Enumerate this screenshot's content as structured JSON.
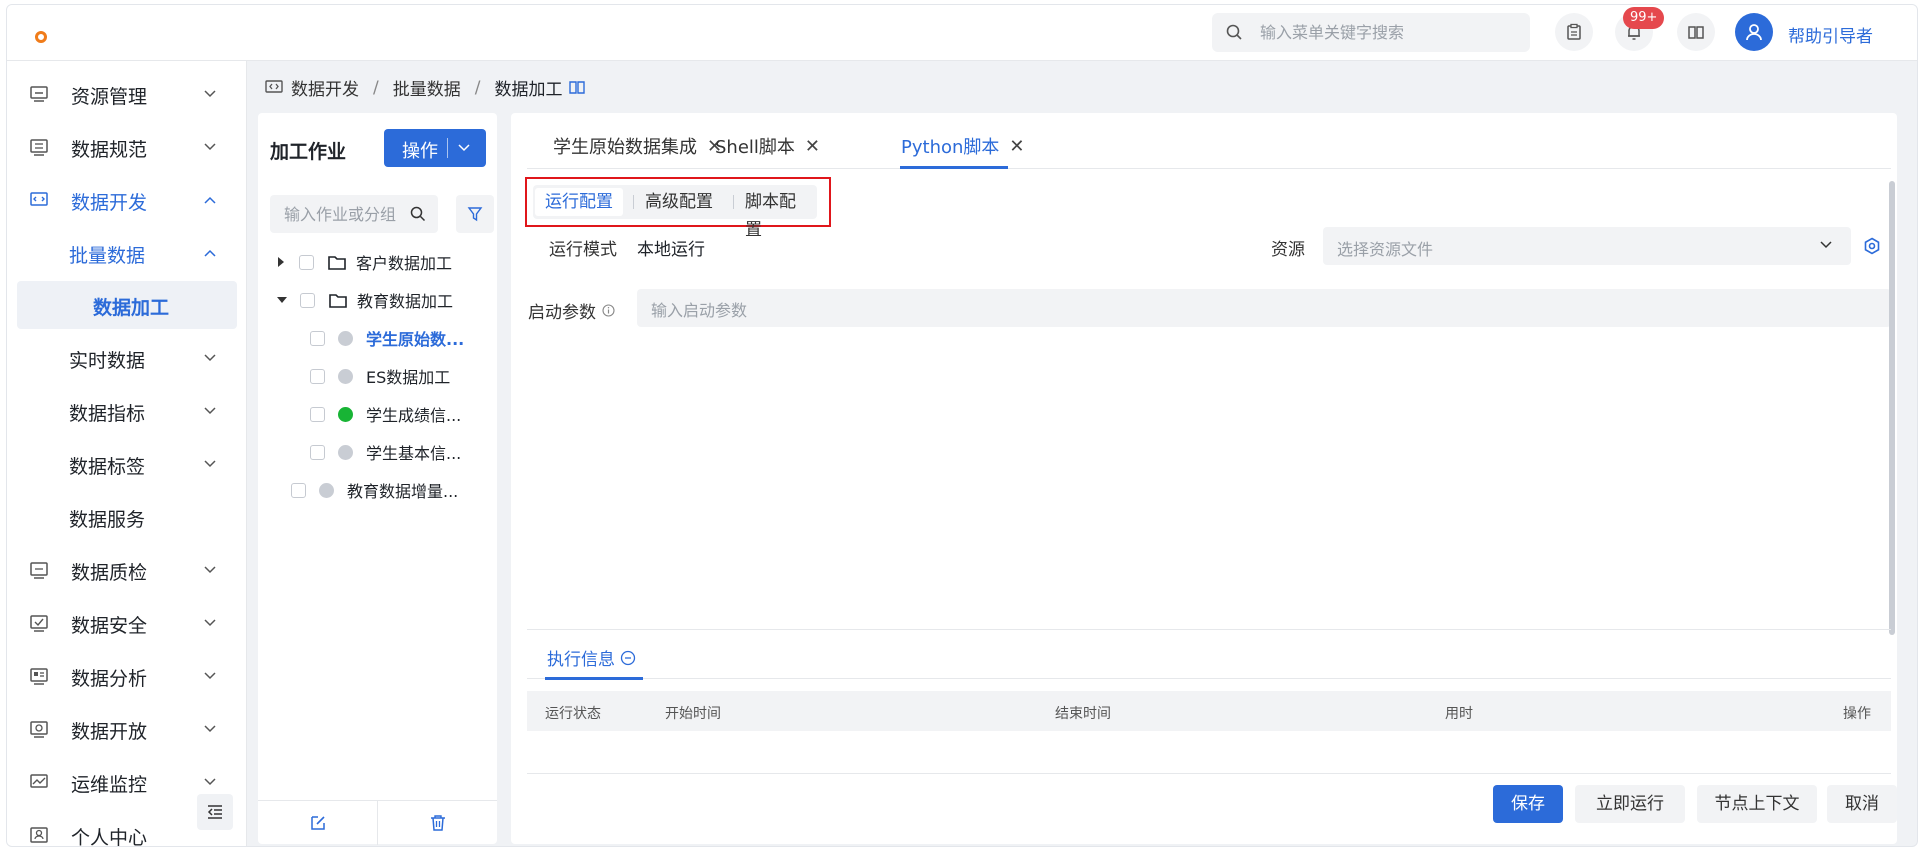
{
  "header": {
    "search_placeholder": "输入菜单关键字搜索",
    "notification_count": "99+",
    "username": "帮助引导者"
  },
  "sidebar": {
    "items": [
      {
        "label": "资源管理",
        "icon": "server-icon"
      },
      {
        "label": "数据规范",
        "icon": "document-icon"
      },
      {
        "label": "数据开发",
        "icon": "code-icon"
      },
      {
        "label": "批量数据"
      },
      {
        "label": "数据加工"
      },
      {
        "label": "实时数据"
      },
      {
        "label": "数据指标"
      },
      {
        "label": "数据标签"
      },
      {
        "label": "数据服务"
      },
      {
        "label": "数据质检",
        "icon": "inspect-icon"
      },
      {
        "label": "数据安全",
        "icon": "shield-icon"
      },
      {
        "label": "数据分析",
        "icon": "analysis-icon"
      },
      {
        "label": "数据开放",
        "icon": "open-icon"
      },
      {
        "label": "运维监控",
        "icon": "monitor-icon"
      },
      {
        "label": "个人中心",
        "icon": "user-icon"
      }
    ],
    "accent_color": "#2c6bd9"
  },
  "breadcrumb": [
    "数据开发",
    "批量数据",
    "数据加工"
  ],
  "job_panel": {
    "title": "加工作业",
    "operate_label": "操作",
    "search_placeholder": "输入作业或分组",
    "tree": [
      {
        "label": "客户数据加工",
        "type": "folder"
      },
      {
        "label": "教育数据加工",
        "type": "folder"
      },
      {
        "label": "学生原始数...",
        "type": "job",
        "status": "gray",
        "selected": true
      },
      {
        "label": "ES数据加工",
        "type": "job",
        "status": "gray"
      },
      {
        "label": "学生成绩信...",
        "type": "job",
        "status": "green"
      },
      {
        "label": "学生基本信...",
        "type": "job",
        "status": "gray"
      },
      {
        "label": "教育数据增量...",
        "type": "job",
        "status": "gray"
      }
    ]
  },
  "file_tabs": [
    {
      "label": "学生原始数据集成"
    },
    {
      "label": "Shell脚本"
    },
    {
      "label": "Python脚本",
      "active": true
    }
  ],
  "config_tabs": [
    "运行配置",
    "高级配置",
    "脚本配置"
  ],
  "form": {
    "run_mode_label": "运行模式",
    "run_mode_value": "本地运行",
    "resource_label": "资源",
    "resource_placeholder": "选择资源文件",
    "args_label": "启动参数",
    "args_placeholder": "输入启动参数"
  },
  "exec": {
    "tab_label": "执行信息",
    "columns": [
      "运行状态",
      "开始时间",
      "结束时间",
      "用时",
      "操作"
    ]
  },
  "actions": {
    "save": "保存",
    "run_now": "立即运行",
    "node_context": "节点上下文",
    "cancel": "取消"
  }
}
